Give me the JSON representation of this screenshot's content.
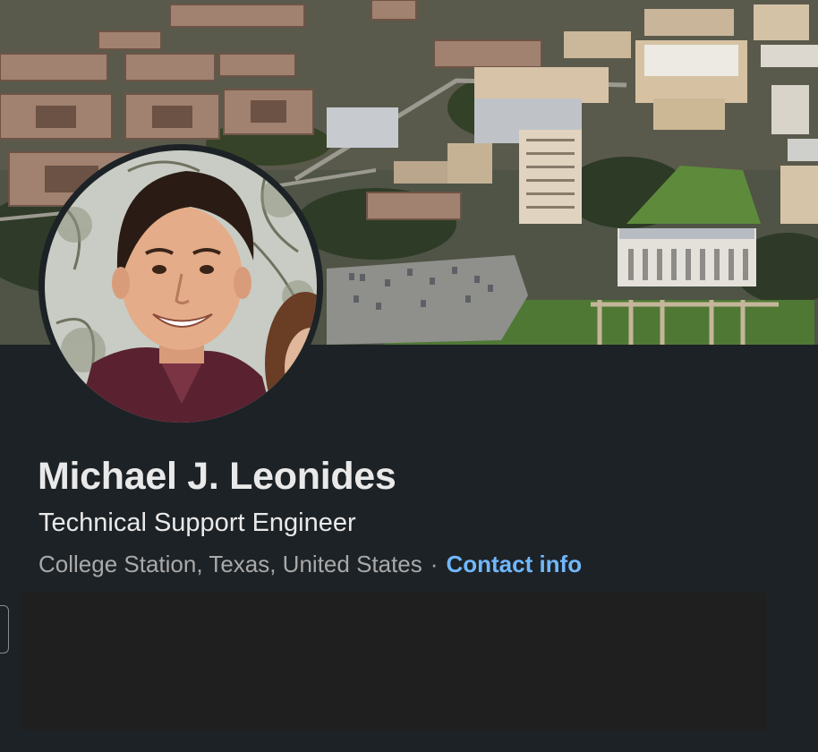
{
  "profile": {
    "name": "Michael J. Leonides",
    "headline": "Technical Support Engineer",
    "location": "College Station, Texas, United States",
    "separator": "·",
    "contact_info_label": "Contact info"
  },
  "colors": {
    "page_background": "#1d2226",
    "primary_text": "#e9e9e9",
    "secondary_text": "#a9a9a9",
    "link": "#71b7fb",
    "panel": "#1f1f1f"
  }
}
